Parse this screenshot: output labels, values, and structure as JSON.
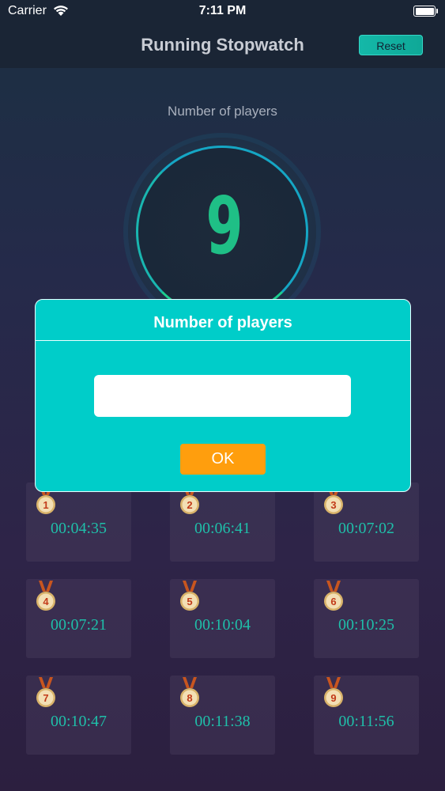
{
  "status_bar": {
    "carrier": "Carrier",
    "time": "7:11 PM"
  },
  "nav": {
    "title": "Running Stopwatch",
    "reset_label": "Reset"
  },
  "main": {
    "players_label": "Number of players",
    "player_count": "9"
  },
  "results": [
    {
      "rank": "1",
      "time": "00:04:35"
    },
    {
      "rank": "2",
      "time": "00:06:41"
    },
    {
      "rank": "3",
      "time": "00:07:02"
    },
    {
      "rank": "4",
      "time": "00:07:21"
    },
    {
      "rank": "5",
      "time": "00:10:04"
    },
    {
      "rank": "6",
      "time": "00:10:25"
    },
    {
      "rank": "7",
      "time": "00:10:47"
    },
    {
      "rank": "8",
      "time": "00:11:38"
    },
    {
      "rank": "9",
      "time": "00:11:56"
    }
  ],
  "dialog": {
    "title": "Number of players",
    "input_value": "",
    "ok_label": "OK"
  },
  "colors": {
    "accent_teal": "#00cdc9",
    "ok_orange": "#ff9e0d",
    "time_text": "#1fbfa9",
    "dial_number": "#1fbf86"
  }
}
